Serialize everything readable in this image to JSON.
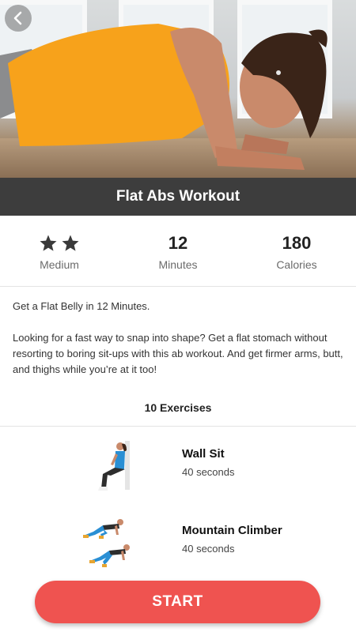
{
  "hero": {
    "image_name": "woman-plank-photo",
    "back_icon": "chevron-left-icon"
  },
  "title": "Flat Abs Workout",
  "stats": {
    "difficulty": {
      "stars": 2,
      "icon": "star-icon",
      "label": "Medium"
    },
    "duration": {
      "value": "12",
      "label": "Minutes"
    },
    "calories": {
      "value": "180",
      "label": "Calories"
    }
  },
  "description": {
    "headline": "Get a Flat Belly in 12 Minutes.",
    "body": "Looking for a fast way to snap into shape? Get a flat stomach without resorting to boring sit-ups with this ab workout. And get firmer arms, butt, and thighs while you’re at it too!"
  },
  "exercises_heading": "10 Exercises",
  "exercises": [
    {
      "name": "Wall Sit",
      "duration": "40 seconds",
      "icon": "wall-sit-illustration"
    },
    {
      "name": "Mountain Climber",
      "duration": "40 seconds",
      "icon": "mountain-climber-illustration"
    }
  ],
  "start_label": "START",
  "colors": {
    "accent": "#ef5350",
    "title_bar": "#3d3d3d",
    "shirt": "#f7a21b",
    "leggings": "#2a8fd4"
  }
}
